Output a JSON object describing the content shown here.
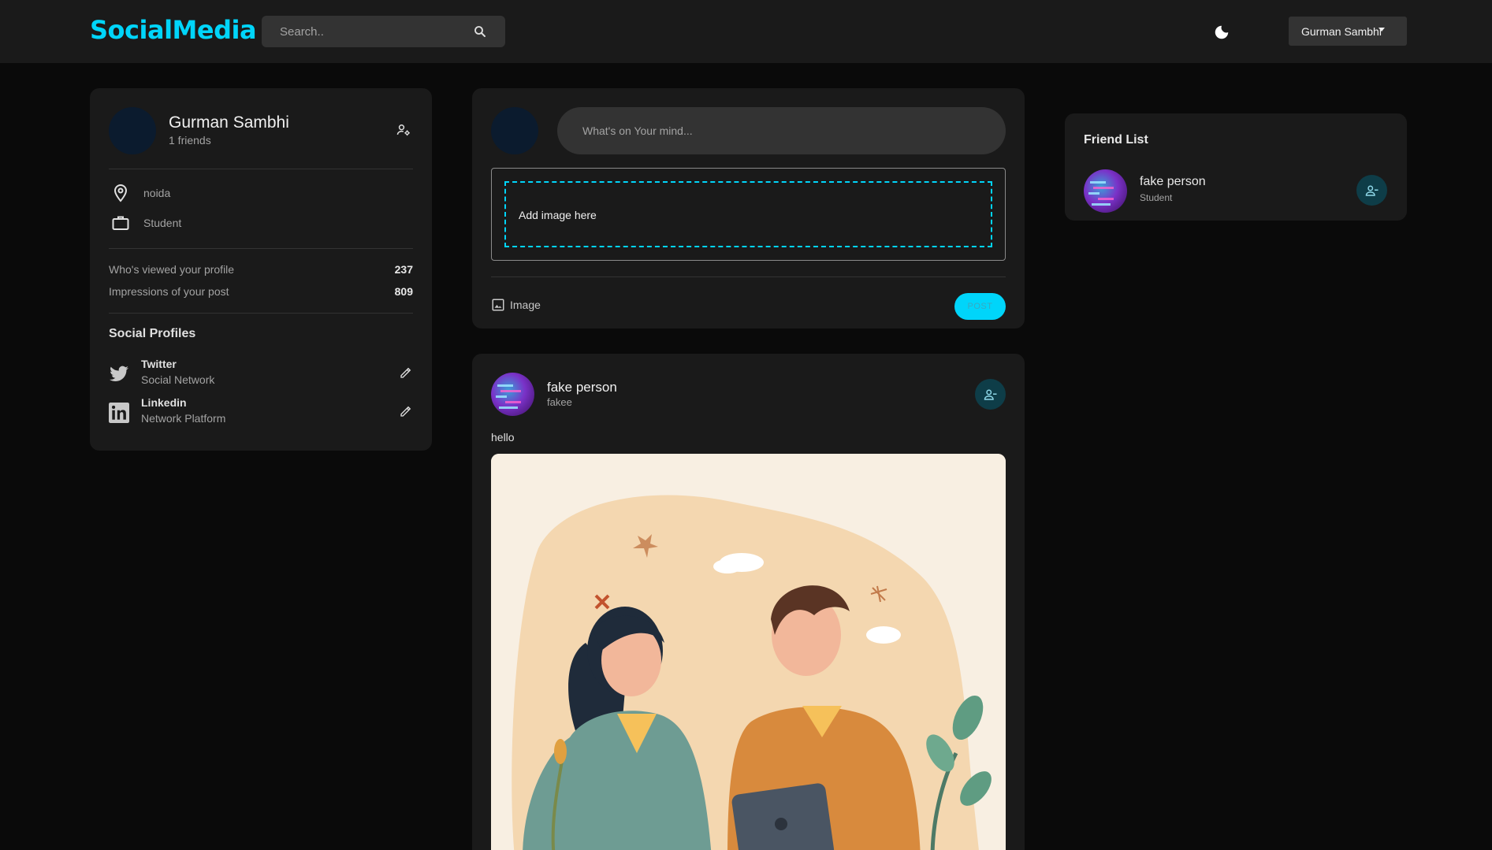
{
  "header": {
    "logo": "SocialMedia",
    "search_placeholder": "Search..",
    "user_select_value": "Gurman Sambhi"
  },
  "profile": {
    "name": "Gurman Sambhi",
    "friends": "1 friends",
    "location": "noida",
    "occupation": "Student",
    "stats": [
      {
        "label": "Who's viewed your profile",
        "value": "237"
      },
      {
        "label": "Impressions of your post",
        "value": "809"
      }
    ],
    "social_title": "Social Profiles",
    "socials": [
      {
        "name": "Twitter",
        "sub": "Social Network"
      },
      {
        "name": "Linkedin",
        "sub": "Network Platform"
      }
    ]
  },
  "create_post": {
    "placeholder": "What's on Your mind...",
    "dropzone_text": "Add image here",
    "image_label": "Image",
    "post_button": "POST"
  },
  "feed": {
    "posts": [
      {
        "author": "fake person",
        "location": "fakee",
        "text": "hello"
      }
    ]
  },
  "friend_list": {
    "title": "Friend List",
    "friends": [
      {
        "name": "fake person",
        "occupation": "Student"
      }
    ]
  },
  "colors": {
    "accent": "#00d5fa",
    "background": "#0a0a0a",
    "card": "#1a1a1a",
    "input": "#333333"
  },
  "icons": [
    "search-icon",
    "moon-icon",
    "manage-accounts-icon",
    "location-icon",
    "work-icon",
    "twitter-icon",
    "linkedin-icon",
    "edit-icon",
    "image-icon",
    "person-remove-icon"
  ]
}
